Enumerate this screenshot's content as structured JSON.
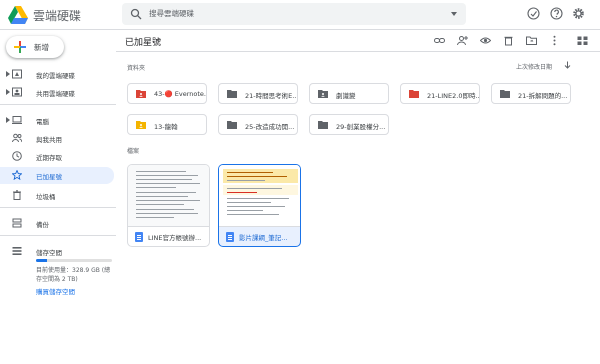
{
  "app": {
    "title": "雲端硬碟",
    "search_placeholder": "搜尋雲端硬碟"
  },
  "sidebar": {
    "new_label": "新增",
    "items": [
      {
        "label": "我的雲端硬碟",
        "icon": "my-drive-icon"
      },
      {
        "label": "共用雲端硬碟",
        "icon": "shared-drive-icon"
      },
      {
        "label": "電腦",
        "icon": "computer-icon"
      },
      {
        "label": "與我共用",
        "icon": "people-icon"
      },
      {
        "label": "近期存取",
        "icon": "clock-icon"
      },
      {
        "label": "已加星號",
        "icon": "star-icon"
      },
      {
        "label": "垃圾桶",
        "icon": "trash-icon"
      },
      {
        "label": "備份",
        "icon": "backup-icon"
      },
      {
        "label": "儲存空間",
        "icon": "storage-icon"
      }
    ],
    "storage_fraction": 0.148,
    "storage_text": "目前使用量：328.9 GB (總存空間為 2 TB)",
    "storage_link": "購買儲存空間"
  },
  "main": {
    "title": "已加星號",
    "folders_label": "資料夾",
    "files_label": "檔案",
    "sort_label": "上次修改日期",
    "folders": [
      {
        "name": "43-🔴 Evernote...",
        "color": "#db4437",
        "shared": true
      },
      {
        "name": "21-時間思考術E...",
        "color": "#5f6368",
        "shared": false
      },
      {
        "name": "劇識變",
        "color": "#5f6368",
        "shared": true
      },
      {
        "name": "21-LINE2.0即時...",
        "color": "#db4437",
        "shared": false
      },
      {
        "name": "21-拆解問題的...",
        "color": "#5f6368",
        "shared": false
      },
      {
        "name": "13-龍翰",
        "color": "#f4b400",
        "shared": true
      },
      {
        "name": "25-改造成功開...",
        "color": "#5f6368",
        "shared": false
      },
      {
        "name": "29-創業股權分...",
        "color": "#5f6368",
        "shared": false
      }
    ],
    "files": [
      {
        "name": "LINE官方帳號辦..."
      },
      {
        "name": "影片課綱_筆記..."
      }
    ]
  },
  "colors": {
    "accent": "#1a73e8",
    "selected_bg": "#e8f0fe",
    "folder_red": "#db4437",
    "folder_gray": "#5f6368",
    "folder_yellow": "#f4b400"
  }
}
